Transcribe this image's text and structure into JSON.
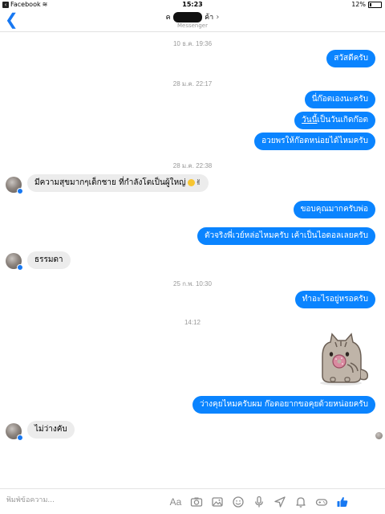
{
  "status_bar": {
    "app": "Facebook",
    "time": "15:23",
    "battery": "12%"
  },
  "nav": {
    "name_suffix": "ค้า",
    "subtitle": "Messenger"
  },
  "timestamps": [
    "10 ธ.ค. 19:36",
    "28 ม.ค. 22:17",
    "28 ม.ค. 22:38",
    "25 ก.พ. 10:30",
    "14:12"
  ],
  "messages": {
    "m1": "สวัสดีครับ",
    "m2": "นี่ก๊อตเองนะครับ",
    "m3_underlined": "วันนี้",
    "m3_rest": "เป็นวันเกิดก๊อต",
    "m4": "อวยพรให้ก๊อตหน่อยได้ไหมครับ",
    "m5": "มีความสุขมากๆเด็กชาย ที่กำลังโตเป็นผู้ใหญ่",
    "m6": "ขอบคุณมากครับพ่อ",
    "m7": "ตัวจริงพี่เวย์หล่อไหมครับ เค้าเป็นไอดอลเลยครับ",
    "m8": "ธรรมดา",
    "m9": "ทำอะไรอยู่หรอครับ",
    "m10": "ว่างคุยไหมครับผม ก๊อตอยากขอคุยด้วยหน่อยครับ",
    "m11": "ไม่ว่างคับ"
  },
  "composer": {
    "placeholder": "พิมพ์ข้อความ...",
    "aa_label": "Aa"
  },
  "colors": {
    "accent": "#1778f2",
    "outgoing_bubble": "#0a84ff",
    "incoming_bubble": "#ececec"
  },
  "icons": [
    "back-chevron-icon",
    "camera-icon",
    "gallery-icon",
    "emoji-icon",
    "microphone-icon",
    "location-icon",
    "bell-icon",
    "games-icon",
    "thumbs-up-icon"
  ]
}
